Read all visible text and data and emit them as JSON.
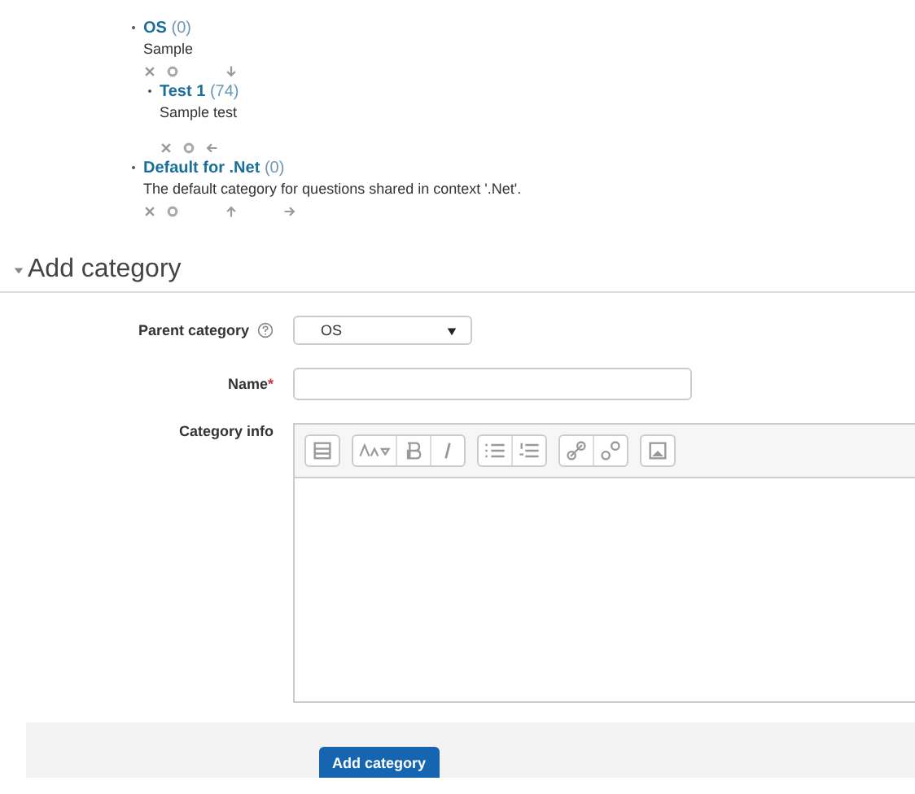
{
  "categories": [
    {
      "name": "OS",
      "count": "(0)",
      "description": "Sample",
      "actions": [
        {
          "kind": "delete"
        },
        {
          "kind": "edit"
        },
        {
          "kind": "down"
        }
      ],
      "children": [
        {
          "name": "Test 1",
          "count": "(74)",
          "description": "Sample test",
          "actions": [
            {
              "kind": "delete"
            },
            {
              "kind": "edit"
            },
            {
              "kind": "left"
            }
          ]
        }
      ]
    },
    {
      "name": "Default for .Net",
      "count": "(0)",
      "description": "The default category for questions shared in context '.Net'.",
      "actions": [
        {
          "kind": "delete"
        },
        {
          "kind": "edit"
        },
        {
          "kind": "up"
        },
        {
          "kind": "right"
        }
      ]
    }
  ],
  "section": {
    "title": "Add category",
    "expanded": true
  },
  "form": {
    "parent_label": "Parent category",
    "parent_value": "OS",
    "name_label": "Name",
    "name_required": "*",
    "info_label": "Category info"
  },
  "submit": "Add category"
}
